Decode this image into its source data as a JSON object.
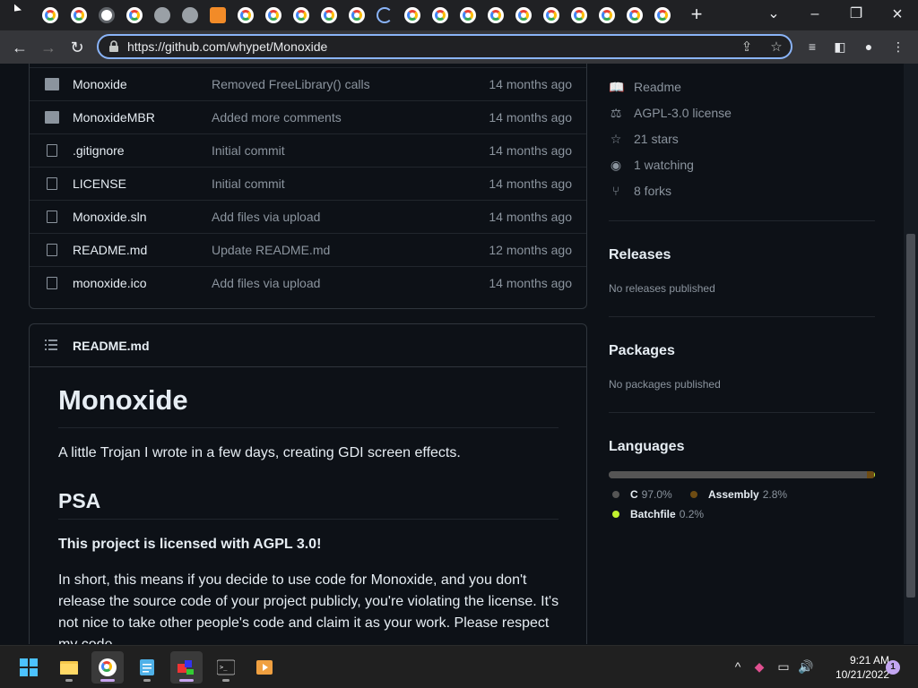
{
  "browser": {
    "url": "https://github.com/whypet/Monoxide",
    "new_tab": "+",
    "icons": [
      "google-favicon",
      "shield-icon",
      "share-icon",
      "star-icon",
      "media-icon",
      "sidebar-icon",
      "profile-icon",
      "menu-icon"
    ]
  },
  "files": [
    {
      "type": "folder",
      "name": "Monoxide",
      "message": "Removed FreeLibrary() calls",
      "age": "14 months ago"
    },
    {
      "type": "folder",
      "name": "MonoxideMBR",
      "message": "Added more comments",
      "age": "14 months ago"
    },
    {
      "type": "file",
      "name": ".gitignore",
      "message": "Initial commit",
      "age": "14 months ago"
    },
    {
      "type": "file",
      "name": "LICENSE",
      "message": "Initial commit",
      "age": "14 months ago"
    },
    {
      "type": "file",
      "name": "Monoxide.sln",
      "message": "Add files via upload",
      "age": "14 months ago"
    },
    {
      "type": "file",
      "name": "README.md",
      "message": "Update README.md",
      "age": "12 months ago"
    },
    {
      "type": "file",
      "name": "monoxide.ico",
      "message": "Add files via upload",
      "age": "14 months ago"
    }
  ],
  "readme": {
    "header": "README.md",
    "h1": "Monoxide",
    "intro": "A little Trojan I wrote in a few days, creating GDI screen effects.",
    "h2": "PSA",
    "license_note": "This project is licensed with AGPL 3.0!",
    "paragraph": "In short, this means if you decide to use code for Monoxide, and you don't release the source code of your project publicly, you're violating the license. It's not nice to take other people's code and claim it as your work. Please respect my code."
  },
  "sidebar": {
    "readme": "Readme",
    "license": "AGPL-3.0 license",
    "stars": "21 stars",
    "watching": "1 watching",
    "forks": "8 forks",
    "releases_title": "Releases",
    "releases_sub": "No releases published",
    "packages_title": "Packages",
    "packages_sub": "No packages published",
    "languages_title": "Languages",
    "languages": [
      {
        "name": "C",
        "percent": "97.0%",
        "value": 97.0,
        "color": "#555555"
      },
      {
        "name": "Assembly",
        "percent": "2.8%",
        "value": 2.8,
        "color": "#6E4C13"
      },
      {
        "name": "Batchfile",
        "percent": "0.2%",
        "value": 0.2,
        "color": "#C1F12E"
      }
    ]
  },
  "taskbar": {
    "time": "9:21 AM",
    "date": "10/21/2022",
    "notifications": "1"
  }
}
